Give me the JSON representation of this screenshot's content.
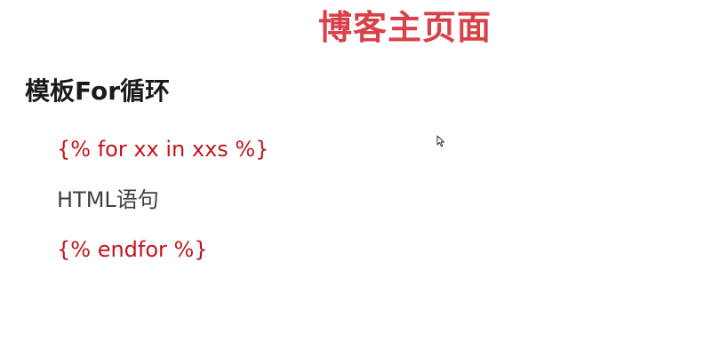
{
  "slide": {
    "title": "博客主页面",
    "heading": "模板For循环",
    "lines": [
      {
        "text": "{% for xx in xxs %}",
        "color": "#c0161c"
      },
      {
        "text": "HTML语句",
        "color": "#404040"
      },
      {
        "text": "{% endfor %}",
        "color": "#c0161c"
      }
    ]
  },
  "colors": {
    "title": "#d94149",
    "heading": "#1a1a1a"
  },
  "cursor": {
    "icon": "mouse-pointer-icon"
  }
}
